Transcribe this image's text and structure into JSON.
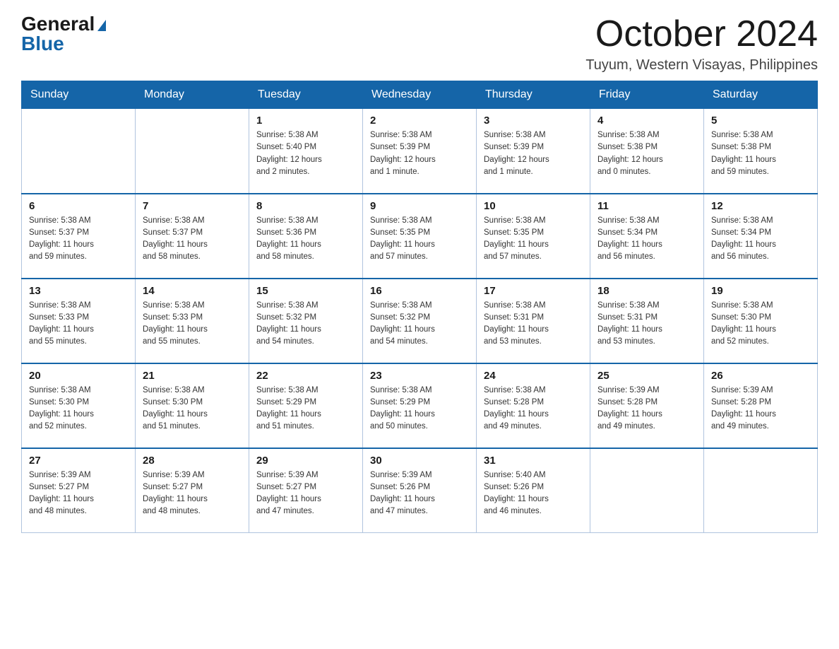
{
  "header": {
    "logo_general": "General",
    "logo_blue": "Blue",
    "month_title": "October 2024",
    "location": "Tuyum, Western Visayas, Philippines"
  },
  "calendar": {
    "days_of_week": [
      "Sunday",
      "Monday",
      "Tuesday",
      "Wednesday",
      "Thursday",
      "Friday",
      "Saturday"
    ],
    "weeks": [
      [
        {
          "day": "",
          "info": ""
        },
        {
          "day": "",
          "info": ""
        },
        {
          "day": "1",
          "info": "Sunrise: 5:38 AM\nSunset: 5:40 PM\nDaylight: 12 hours\nand 2 minutes."
        },
        {
          "day": "2",
          "info": "Sunrise: 5:38 AM\nSunset: 5:39 PM\nDaylight: 12 hours\nand 1 minute."
        },
        {
          "day": "3",
          "info": "Sunrise: 5:38 AM\nSunset: 5:39 PM\nDaylight: 12 hours\nand 1 minute."
        },
        {
          "day": "4",
          "info": "Sunrise: 5:38 AM\nSunset: 5:38 PM\nDaylight: 12 hours\nand 0 minutes."
        },
        {
          "day": "5",
          "info": "Sunrise: 5:38 AM\nSunset: 5:38 PM\nDaylight: 11 hours\nand 59 minutes."
        }
      ],
      [
        {
          "day": "6",
          "info": "Sunrise: 5:38 AM\nSunset: 5:37 PM\nDaylight: 11 hours\nand 59 minutes."
        },
        {
          "day": "7",
          "info": "Sunrise: 5:38 AM\nSunset: 5:37 PM\nDaylight: 11 hours\nand 58 minutes."
        },
        {
          "day": "8",
          "info": "Sunrise: 5:38 AM\nSunset: 5:36 PM\nDaylight: 11 hours\nand 58 minutes."
        },
        {
          "day": "9",
          "info": "Sunrise: 5:38 AM\nSunset: 5:35 PM\nDaylight: 11 hours\nand 57 minutes."
        },
        {
          "day": "10",
          "info": "Sunrise: 5:38 AM\nSunset: 5:35 PM\nDaylight: 11 hours\nand 57 minutes."
        },
        {
          "day": "11",
          "info": "Sunrise: 5:38 AM\nSunset: 5:34 PM\nDaylight: 11 hours\nand 56 minutes."
        },
        {
          "day": "12",
          "info": "Sunrise: 5:38 AM\nSunset: 5:34 PM\nDaylight: 11 hours\nand 56 minutes."
        }
      ],
      [
        {
          "day": "13",
          "info": "Sunrise: 5:38 AM\nSunset: 5:33 PM\nDaylight: 11 hours\nand 55 minutes."
        },
        {
          "day": "14",
          "info": "Sunrise: 5:38 AM\nSunset: 5:33 PM\nDaylight: 11 hours\nand 55 minutes."
        },
        {
          "day": "15",
          "info": "Sunrise: 5:38 AM\nSunset: 5:32 PM\nDaylight: 11 hours\nand 54 minutes."
        },
        {
          "day": "16",
          "info": "Sunrise: 5:38 AM\nSunset: 5:32 PM\nDaylight: 11 hours\nand 54 minutes."
        },
        {
          "day": "17",
          "info": "Sunrise: 5:38 AM\nSunset: 5:31 PM\nDaylight: 11 hours\nand 53 minutes."
        },
        {
          "day": "18",
          "info": "Sunrise: 5:38 AM\nSunset: 5:31 PM\nDaylight: 11 hours\nand 53 minutes."
        },
        {
          "day": "19",
          "info": "Sunrise: 5:38 AM\nSunset: 5:30 PM\nDaylight: 11 hours\nand 52 minutes."
        }
      ],
      [
        {
          "day": "20",
          "info": "Sunrise: 5:38 AM\nSunset: 5:30 PM\nDaylight: 11 hours\nand 52 minutes."
        },
        {
          "day": "21",
          "info": "Sunrise: 5:38 AM\nSunset: 5:30 PM\nDaylight: 11 hours\nand 51 minutes."
        },
        {
          "day": "22",
          "info": "Sunrise: 5:38 AM\nSunset: 5:29 PM\nDaylight: 11 hours\nand 51 minutes."
        },
        {
          "day": "23",
          "info": "Sunrise: 5:38 AM\nSunset: 5:29 PM\nDaylight: 11 hours\nand 50 minutes."
        },
        {
          "day": "24",
          "info": "Sunrise: 5:38 AM\nSunset: 5:28 PM\nDaylight: 11 hours\nand 49 minutes."
        },
        {
          "day": "25",
          "info": "Sunrise: 5:39 AM\nSunset: 5:28 PM\nDaylight: 11 hours\nand 49 minutes."
        },
        {
          "day": "26",
          "info": "Sunrise: 5:39 AM\nSunset: 5:28 PM\nDaylight: 11 hours\nand 49 minutes."
        }
      ],
      [
        {
          "day": "27",
          "info": "Sunrise: 5:39 AM\nSunset: 5:27 PM\nDaylight: 11 hours\nand 48 minutes."
        },
        {
          "day": "28",
          "info": "Sunrise: 5:39 AM\nSunset: 5:27 PM\nDaylight: 11 hours\nand 48 minutes."
        },
        {
          "day": "29",
          "info": "Sunrise: 5:39 AM\nSunset: 5:27 PM\nDaylight: 11 hours\nand 47 minutes."
        },
        {
          "day": "30",
          "info": "Sunrise: 5:39 AM\nSunset: 5:26 PM\nDaylight: 11 hours\nand 47 minutes."
        },
        {
          "day": "31",
          "info": "Sunrise: 5:40 AM\nSunset: 5:26 PM\nDaylight: 11 hours\nand 46 minutes."
        },
        {
          "day": "",
          "info": ""
        },
        {
          "day": "",
          "info": ""
        }
      ]
    ]
  }
}
